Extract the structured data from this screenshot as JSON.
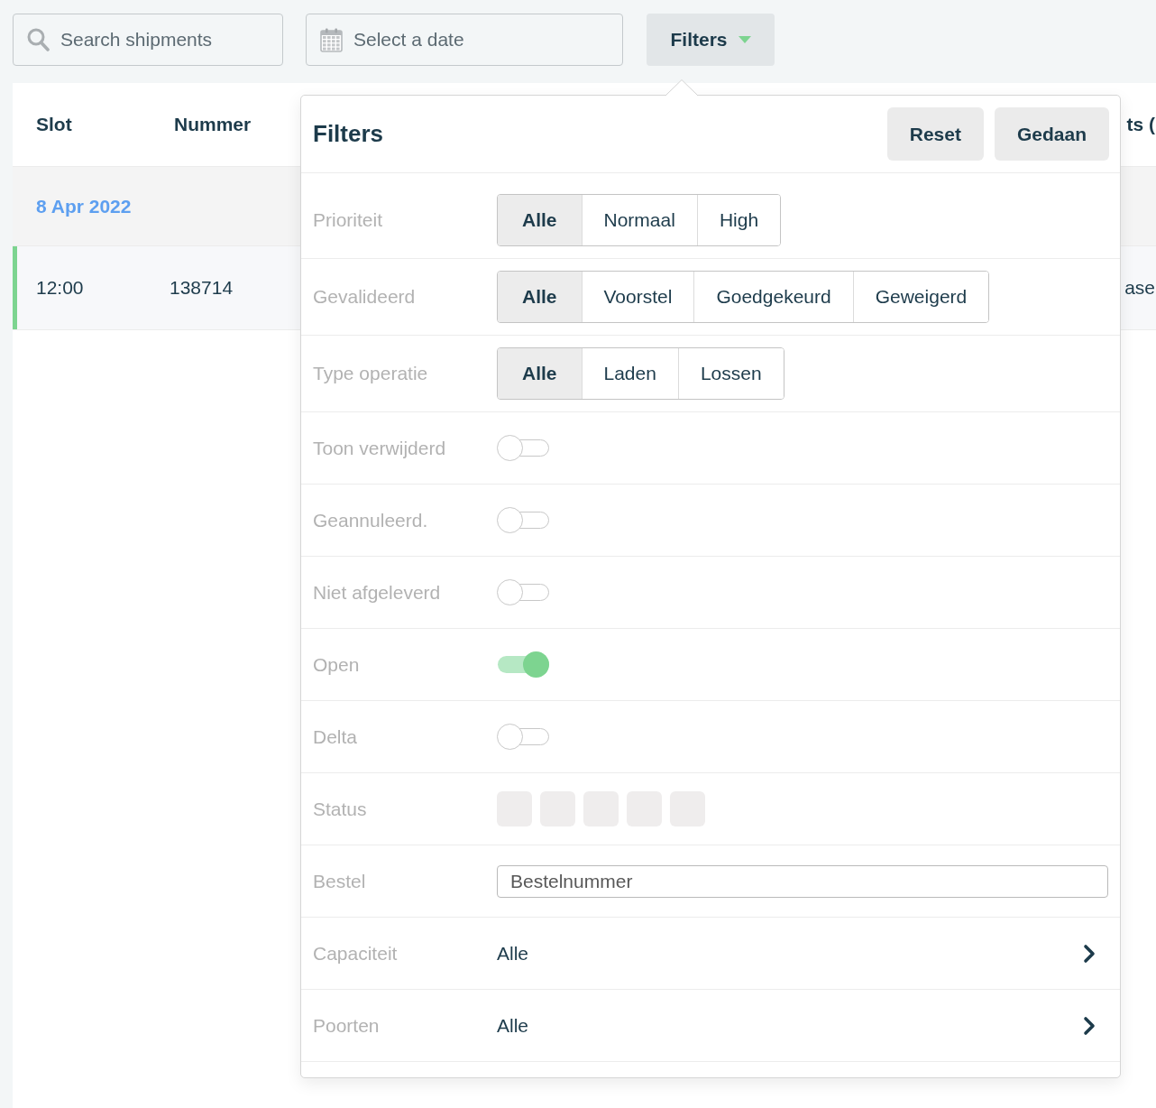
{
  "toolbar": {
    "search": {
      "placeholder": "Search shipments"
    },
    "date": {
      "placeholder": "Select a date"
    },
    "filters_button": {
      "label": "Filters",
      "expanded": true
    }
  },
  "table": {
    "columns": [
      {
        "label": "Slot"
      },
      {
        "label": "Nummer"
      },
      {
        "label": "ts ("
      }
    ],
    "groups": [
      {
        "date": "8 Apr 2022",
        "rows": [
          {
            "color": "#7dd490",
            "cells": [
              "12:00",
              "138714",
              "ase"
            ]
          }
        ]
      }
    ]
  },
  "filter_panel": {
    "title": "Filters",
    "actions": [
      "Reset",
      "Gedaan"
    ],
    "rows": [
      {
        "kind": "segmented",
        "label": "Prioriteit",
        "options": [
          {
            "label": "Alle",
            "selected": true
          },
          {
            "label": "Normaal",
            "selected": false
          },
          {
            "label": "High",
            "selected": false
          }
        ]
      },
      {
        "kind": "segmented",
        "label": "Gevalideerd",
        "options": [
          {
            "label": "Alle",
            "selected": true
          },
          {
            "label": "Voorstel",
            "selected": false
          },
          {
            "label": "Goedgekeurd",
            "selected": false
          },
          {
            "label": "Geweigerd",
            "selected": false
          }
        ]
      },
      {
        "kind": "segmented",
        "label": "Type operatie",
        "options": [
          {
            "label": "Alle",
            "selected": true
          },
          {
            "label": "Laden",
            "selected": false
          },
          {
            "label": "Lossen",
            "selected": false
          }
        ]
      },
      {
        "kind": "toggle",
        "label": "Toon verwijderd",
        "on": false
      },
      {
        "kind": "toggle",
        "label": "Geannuleerd.",
        "on": false
      },
      {
        "kind": "toggle",
        "label": "Niet afgeleverd",
        "on": false
      },
      {
        "kind": "toggle",
        "label": "Open",
        "on": true
      },
      {
        "kind": "toggle",
        "label": "Delta",
        "on": false
      },
      {
        "kind": "tiles",
        "label": "Status",
        "options": [
          {
            "selected": false
          },
          {
            "selected": false
          },
          {
            "selected": false
          },
          {
            "selected": false
          },
          {
            "selected": false
          }
        ]
      },
      {
        "kind": "field",
        "label": "Bestel",
        "placeholder": "Bestelnummer"
      },
      {
        "kind": "picker",
        "label": "Capaciteit",
        "value": "Alle"
      },
      {
        "kind": "picker",
        "label": "Poorten",
        "value": "Alle"
      }
    ]
  }
}
